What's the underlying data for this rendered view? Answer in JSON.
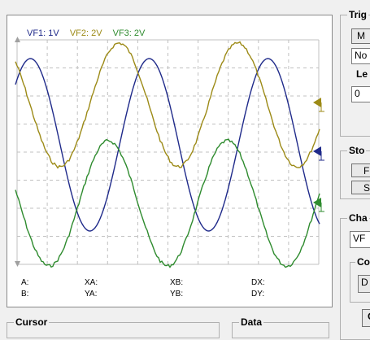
{
  "scope": {
    "legend": [
      {
        "label": "VF1: 1V",
        "color": "#1f2a8a"
      },
      {
        "label": "VF2: 2V",
        "color": "#9c8a16"
      },
      {
        "label": "VF3: 2V",
        "color": "#2e8b2e"
      }
    ],
    "cursor_readout": {
      "a": "A:",
      "b": "B:",
      "xa": "XA:",
      "ya": "YA:",
      "xb": "XB:",
      "yb": "YB:",
      "dx": "DX:",
      "dy": "DY:"
    }
  },
  "panels": {
    "cursor_title": "Cursor",
    "data_title": "Data"
  },
  "trigger": {
    "title": "Trig",
    "mode_button": "M",
    "mode_field": "No",
    "level_label": "Le",
    "level_value": "0"
  },
  "store": {
    "title": "Sto",
    "button1": "F",
    "button2": "S"
  },
  "channel": {
    "title": "Cha",
    "field": "VF",
    "sub_title": "Co",
    "sub_field": "D",
    "bottom_button": "C"
  },
  "colors": {
    "vf1": "#1f2a8a",
    "vf2": "#9c8a16",
    "vf3": "#2e8b2e",
    "grid": "#c0c0c0"
  }
}
